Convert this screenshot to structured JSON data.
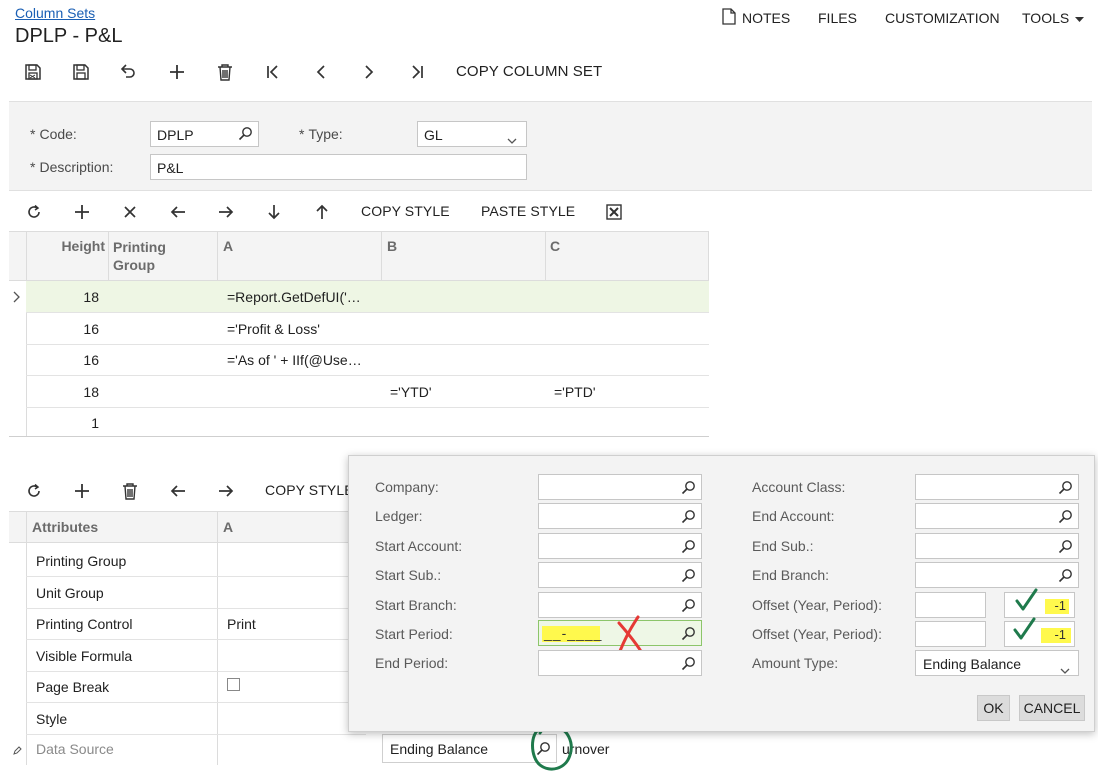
{
  "header": {
    "breadcrumb": "Column Sets",
    "title": "DPLP - P&L",
    "links": {
      "notes": "NOTES",
      "files": "FILES",
      "customization": "CUSTOMIZATION",
      "tools": "TOOLS"
    }
  },
  "toolbar": {
    "icons": [
      "save-close-icon",
      "save-icon",
      "undo-icon",
      "add-icon",
      "delete-icon",
      "first-icon",
      "prev-icon",
      "next-icon",
      "last-icon"
    ],
    "copy_column_set": "COPY COLUMN SET"
  },
  "form": {
    "code_label": "Code:",
    "code_value": "DPLP",
    "type_label": "Type:",
    "type_value": "GL",
    "description_label": "Description:",
    "description_value": "P&L"
  },
  "grid_toolbar": {
    "copy_style": "COPY STYLE",
    "paste_style": "PASTE STYLE"
  },
  "grid": {
    "columns": [
      "Height",
      "Printing Group",
      "A",
      "B",
      "C"
    ],
    "rows": [
      {
        "height": "18",
        "group": "",
        "a": "=Report.GetDefUI('…",
        "b": "",
        "c": ""
      },
      {
        "height": "16",
        "group": "",
        "a": "='Profit & Loss'",
        "b": "",
        "c": ""
      },
      {
        "height": "16",
        "group": "",
        "a": "='As of ' + IIf(@Use…",
        "b": "",
        "c": ""
      },
      {
        "height": "18",
        "group": "",
        "a": "",
        "b": "='YTD'",
        "c": "='PTD'"
      },
      {
        "height": "1",
        "group": "",
        "a": "",
        "b": "",
        "c": ""
      }
    ]
  },
  "attr_toolbar": {
    "copy_style": "COPY STYLE"
  },
  "attributes": {
    "columns": [
      "Attributes",
      "A"
    ],
    "rows": [
      {
        "name": "Printing Group",
        "value": ""
      },
      {
        "name": "Unit Group",
        "value": ""
      },
      {
        "name": "Printing Control",
        "value": "Print"
      },
      {
        "name": "Visible Formula",
        "value": ""
      },
      {
        "name": "Page Break",
        "value": ""
      },
      {
        "name": "Style",
        "value": ""
      },
      {
        "name": "Data Source",
        "value": ""
      }
    ],
    "data_source_value": "Ending Balance",
    "data_source_suffix": "urnover"
  },
  "dialog": {
    "left": [
      {
        "label": "Company:",
        "value": ""
      },
      {
        "label": "Ledger:",
        "value": ""
      },
      {
        "label": "Start Account:",
        "value": ""
      },
      {
        "label": "Start Sub.:",
        "value": ""
      },
      {
        "label": "Start Branch:",
        "value": ""
      },
      {
        "label": "Start Period:",
        "value": "__-____"
      },
      {
        "label": "End Period:",
        "value": ""
      }
    ],
    "right": [
      {
        "label": "Account Class:",
        "value": ""
      },
      {
        "label": "End Account:",
        "value": ""
      },
      {
        "label": "End Sub.:",
        "value": ""
      },
      {
        "label": "End Branch:",
        "value": ""
      }
    ],
    "offset1_label": "Offset (Year, Period):",
    "offset1_year": "",
    "offset1_period": "-1",
    "offset2_label": "Offset (Year, Period):",
    "offset2_year": "",
    "offset2_period": "-1",
    "amount_type_label": "Amount Type:",
    "amount_type_value": "Ending Balance",
    "ok": "OK",
    "cancel": "CANCEL"
  },
  "colors": {
    "accent": "#1a5fb4",
    "selected_row": "#eef6e4",
    "panel": "#f3f3f3",
    "highlight": "#fff94d",
    "check": "#1f7a4c",
    "cross": "#e53935"
  }
}
